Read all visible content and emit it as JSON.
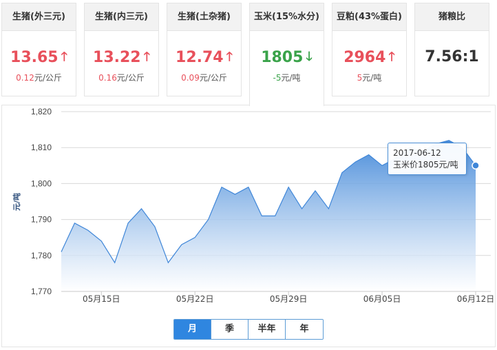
{
  "cards": [
    {
      "title": "生猪(外三元)",
      "price": "13.65",
      "change": "0.12",
      "unit": "元/公斤",
      "trend": "up"
    },
    {
      "title": "生猪(内三元)",
      "price": "13.22",
      "change": "0.16",
      "unit": "元/公斤",
      "trend": "up"
    },
    {
      "title": "生猪(土杂猪)",
      "price": "12.74",
      "change": "0.09",
      "unit": "元/公斤",
      "trend": "up"
    },
    {
      "title": "玉米(15%水分)",
      "price": "1805",
      "change": "-5",
      "unit": "元/吨",
      "trend": "down"
    },
    {
      "title": "豆粕(43%蛋白)",
      "price": "2964",
      "change": "5",
      "unit": "元/吨",
      "trend": "up"
    },
    {
      "title": "猪粮比",
      "price": "7.56:1",
      "change": "",
      "unit": "",
      "trend": "none"
    }
  ],
  "colors": {
    "up": "#e8505b",
    "down": "#3aa34a",
    "line": "#3f86d8",
    "active_tab": "#2f86e0"
  },
  "tooltip": {
    "date": "2017-06-12",
    "label": "玉米价1805元/吨"
  },
  "range_tabs": [
    {
      "label": "月",
      "active": true
    },
    {
      "label": "季",
      "active": false
    },
    {
      "label": "半年",
      "active": false
    },
    {
      "label": "年",
      "active": false
    }
  ],
  "chart_data": {
    "type": "area",
    "title": "",
    "xlabel": "",
    "ylabel": "元/吨",
    "ylim": [
      1770,
      1820
    ],
    "yticks": [
      1770,
      1780,
      1790,
      1800,
      1810,
      1820
    ],
    "ytick_labels": [
      "1,770",
      "1,780",
      "1,790",
      "1,800",
      "1,810",
      "1,820"
    ],
    "xtick_labels": [
      "05月15日",
      "05月22日",
      "05月29日",
      "06月05日",
      "06月12日"
    ],
    "xtick_index": [
      3,
      10,
      17,
      24,
      31
    ],
    "grid": true,
    "legend": "none",
    "x": [
      "05-12",
      "05-13",
      "05-14",
      "05-15",
      "05-16",
      "05-17",
      "05-18",
      "05-19",
      "05-20",
      "05-21",
      "05-22",
      "05-23",
      "05-24",
      "05-25",
      "05-26",
      "05-27",
      "05-28",
      "05-29",
      "05-30",
      "05-31",
      "06-01",
      "06-02",
      "06-03",
      "06-04",
      "06-05",
      "06-06",
      "06-07",
      "06-08",
      "06-09",
      "06-10",
      "06-11",
      "06-12"
    ],
    "values": [
      1781,
      1789,
      1787,
      1784,
      1778,
      1789,
      1793,
      1788,
      1778,
      1783,
      1785,
      1790,
      1799,
      1797,
      1799,
      1791,
      1791,
      1799,
      1793,
      1798,
      1793,
      1803,
      1806,
      1808,
      1805,
      1807,
      1810,
      1809,
      1811,
      1812,
      1810,
      1805
    ]
  }
}
